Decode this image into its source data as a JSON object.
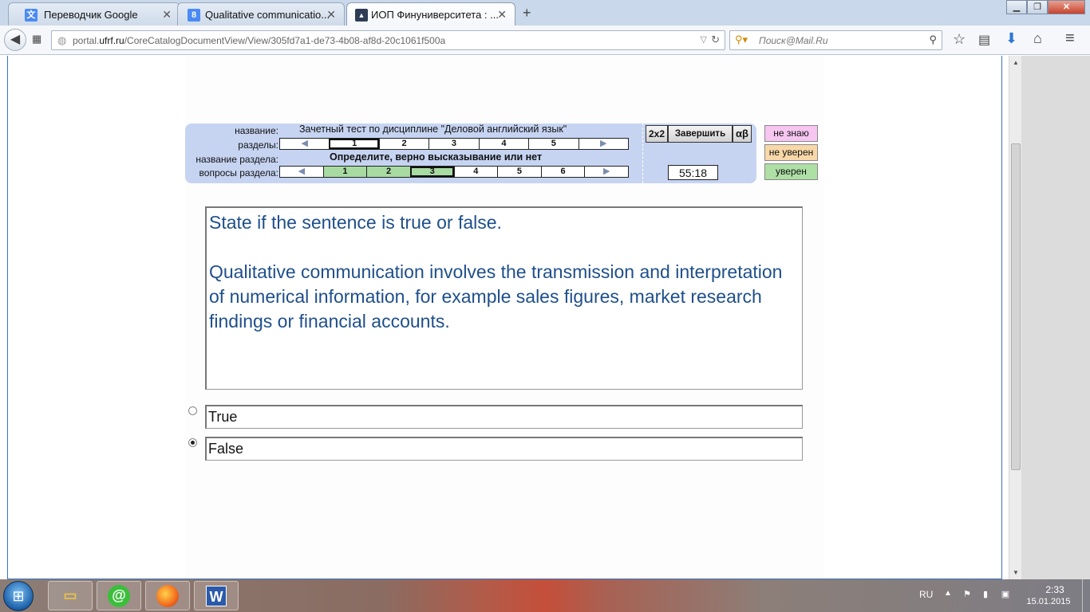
{
  "browser": {
    "tabs": [
      {
        "label": "Переводчик Google",
        "icon": "google-translate-icon",
        "icon_color": "#4a8af4",
        "icon_glyph": "文"
      },
      {
        "label": "Qualitative communicatio...",
        "icon": "google-search-icon",
        "icon_color": "#4a8af4",
        "icon_glyph": "8"
      },
      {
        "label": "ИОП Финуниверситета : ...",
        "icon": "graduation-cap-icon",
        "icon_color": "#2f3c55",
        "icon_glyph": "▲"
      }
    ],
    "new_tab_symbol": "+",
    "url_host": "portal.ufrf.ru",
    "url_path": "/CoreCatalogDocumentView/View/305fd7a1-de73-4b08-af8d-20c1061f500a",
    "url_prefix": "portal.",
    "url_host_main": "ufrf.ru",
    "search_placeholder": "Поиск@Mail.Ru"
  },
  "test": {
    "labels": {
      "name": "название:",
      "sections": "разделы:",
      "section_name": "название раздела:",
      "section_questions": "вопросы раздела:"
    },
    "title": "Зачетный тест по дисциплине \"Деловой английский язык\"",
    "sections": [
      "1",
      "2",
      "3",
      "4",
      "5"
    ],
    "current_section": "1",
    "section_title": "Определите, верно высказывание или нет",
    "questions": [
      "1",
      "2",
      "3",
      "4",
      "5",
      "6"
    ],
    "answered_questions": [
      "1",
      "2",
      "3"
    ],
    "current_question": "3",
    "buttons": {
      "calc": "2x2",
      "finish": "Завершить",
      "greek": "αβ"
    },
    "timer": "55:18",
    "confidence": [
      {
        "label": "не знаю",
        "color": "#f6c6f1"
      },
      {
        "label": "не уверен",
        "color": "#f8d8a8"
      },
      {
        "label": "уверен",
        "color": "#aee0a6"
      }
    ]
  },
  "question": {
    "instruction": "State if the sentence is true or false.",
    "text": "Qualitative communication involves the transmission and interpretation of numerical information, for example sales figures, market research findings or financial accounts.",
    "answers": [
      {
        "label": "True",
        "selected": false
      },
      {
        "label": "False",
        "selected": true
      }
    ]
  },
  "taskbar": {
    "apps": [
      "file-explorer-icon",
      "mail-agent-icon",
      "firefox-icon",
      "word-icon"
    ],
    "word_glyph": "W",
    "mail_glyph": "@",
    "language": "RU",
    "time": "2:33",
    "date": "15.01.2015"
  }
}
